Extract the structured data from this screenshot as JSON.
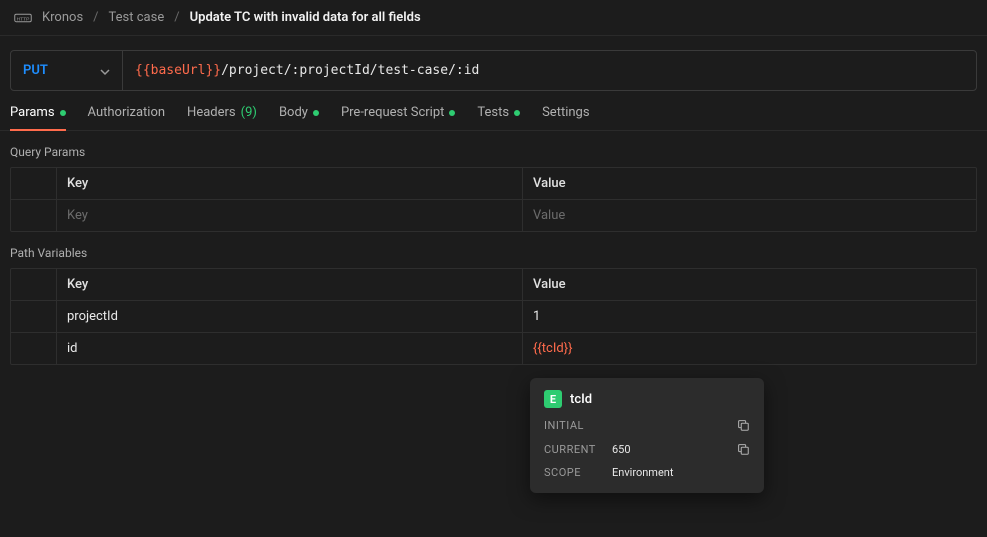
{
  "breadcrumb": {
    "workspace": "Kronos",
    "folder": "Test case",
    "name": "Update TC with invalid data for all fields"
  },
  "request": {
    "method": "PUT",
    "url_var": "{{baseUrl}}",
    "url_path": "/project/:projectId/test-case/:id"
  },
  "tabs": {
    "params": "Params",
    "authorization": "Authorization",
    "headers": "Headers",
    "headers_count": "(9)",
    "body": "Body",
    "prerequest": "Pre-request Script",
    "tests": "Tests",
    "settings": "Settings"
  },
  "sections": {
    "query": "Query Params",
    "path": "Path Variables"
  },
  "table_headers": {
    "key": "Key",
    "value": "Value"
  },
  "query_params": {
    "placeholder_key": "Key",
    "placeholder_value": "Value"
  },
  "path_vars": [
    {
      "key": "projectId",
      "value": "1",
      "is_var": false
    },
    {
      "key": "id",
      "value": "{{tcId}}",
      "is_var": true
    }
  ],
  "tooltip": {
    "badge": "E",
    "name": "tcId",
    "rows": {
      "initial_label": "INITIAL",
      "initial_value": "",
      "current_label": "CURRENT",
      "current_value": "650",
      "scope_label": "SCOPE",
      "scope_value": "Environment"
    }
  }
}
